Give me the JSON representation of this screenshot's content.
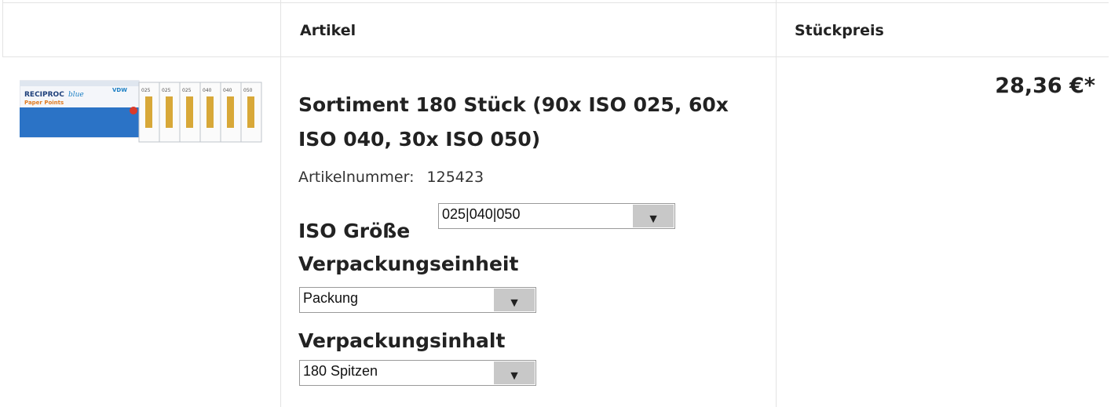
{
  "table": {
    "headers": {
      "article": "Artikel",
      "unit_price": "Stückpreis"
    }
  },
  "product": {
    "image_label": "RECIPROC blue Paper Points",
    "title": "Sortiment 180 Stück (90x ISO 025, 60x ISO 040, 30x ISO 050)",
    "price": "28,36 €*",
    "article_number_label": "Artikelnummer:",
    "article_number": "125423",
    "options": {
      "iso_size": {
        "label": "ISO Größe",
        "value": "025|040|050"
      },
      "packaging_unit": {
        "label": "Verpackungseinheit",
        "value": "Packung"
      },
      "packaging_content": {
        "label": "Verpackungsinhalt",
        "value": "180 Spitzen"
      }
    }
  },
  "colors": {
    "border": "#e3e3e3",
    "select_arrow_bg": "#c8c8c8",
    "brand_blue": "#1b7fc4"
  }
}
